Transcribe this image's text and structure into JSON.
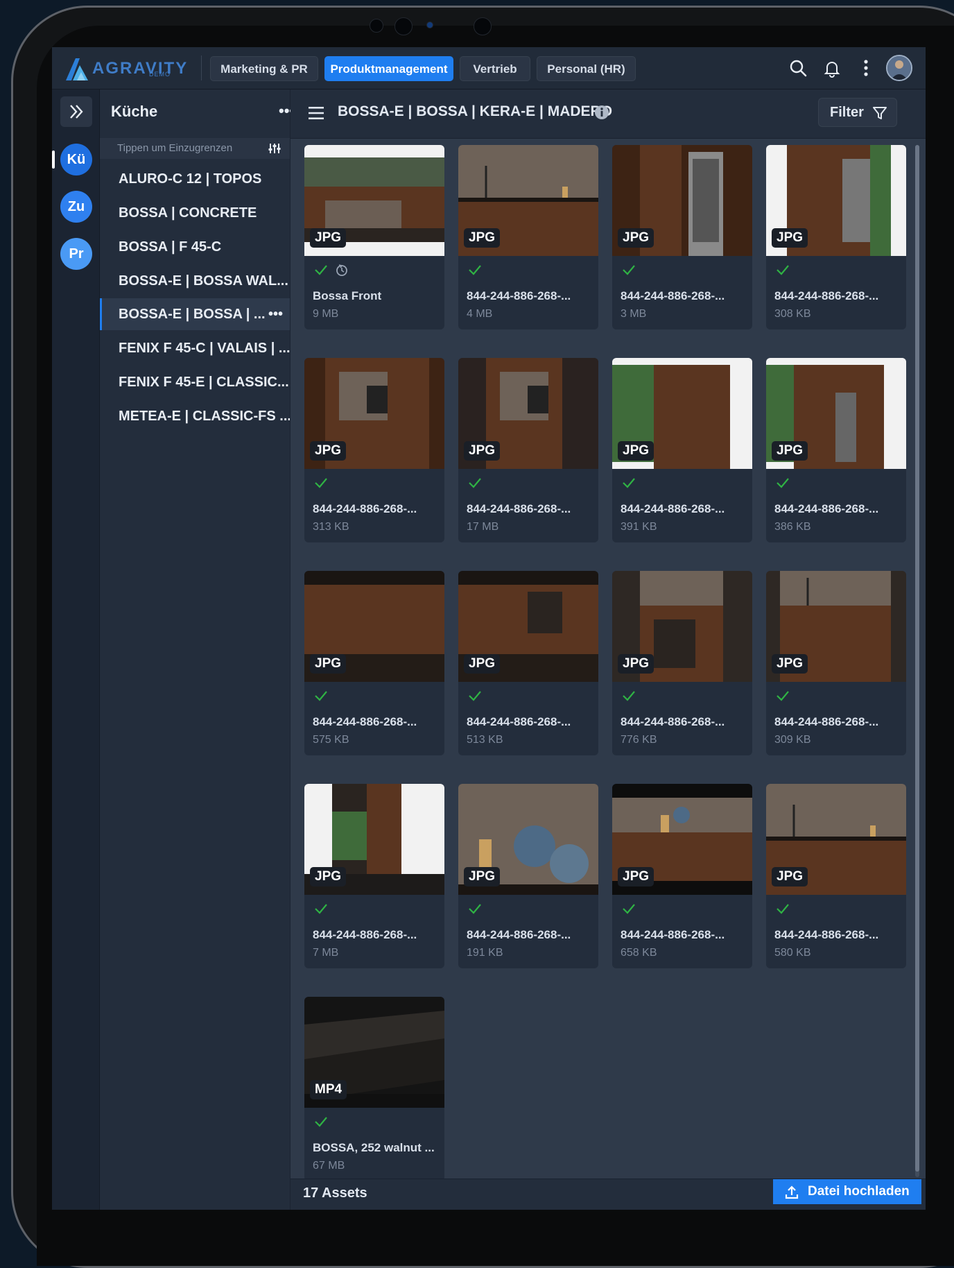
{
  "topbar": {
    "logo_text": "AGRAVITY",
    "logo_sub": "DEMO",
    "tabs": [
      {
        "label": "Marketing & PR",
        "active": false
      },
      {
        "label": "Produktmanagement",
        "active": true
      },
      {
        "label": "Vertrieb",
        "active": false
      },
      {
        "label": "Personal (HR)",
        "active": false
      }
    ],
    "icons": [
      "search-icon",
      "bell-icon",
      "kebab-menu-icon",
      "user-avatar"
    ]
  },
  "rail": {
    "collapse_icon": "double-chevron-right-icon",
    "items": [
      {
        "label": "Kü",
        "color": "#1f6fe0",
        "selected": true
      },
      {
        "label": "Zu",
        "color": "#2f80ef",
        "selected": false
      },
      {
        "label": "Pr",
        "color": "#4a9af5",
        "selected": false
      }
    ]
  },
  "sidebar": {
    "title": "Küche",
    "more": "•••",
    "filter_placeholder": "Tippen um Einzugrenzen",
    "items": [
      {
        "label": "ALURO-C 12 | TOPOS"
      },
      {
        "label": "BOSSA | CONCRETE"
      },
      {
        "label": "BOSSA | F 45-C"
      },
      {
        "label": "BOSSA-E | BOSSA WAL..."
      },
      {
        "label": "BOSSA-E | BOSSA | ...",
        "active": true,
        "more": "•••"
      },
      {
        "label": "FENIX F 45-C | VALAIS | ..."
      },
      {
        "label": "FENIX F 45-E | CLASSIC..."
      },
      {
        "label": "METEA-E | CLASSIC-FS ..."
      }
    ]
  },
  "main": {
    "path": "BOSSA-E | BOSSA | KERA-E | MADERO",
    "filter_label": "Filter",
    "assets": [
      {
        "type": "JPG",
        "name": "Bossa Front",
        "size": "9 MB",
        "thumb": "t1"
      },
      {
        "type": "JPG",
        "name": "844-244-886-268-...",
        "size": "4 MB",
        "thumb": "t2"
      },
      {
        "type": "JPG",
        "name": "844-244-886-268-...",
        "size": "3 MB",
        "thumb": "t3"
      },
      {
        "type": "JPG",
        "name": "844-244-886-268-...",
        "size": "308 KB",
        "thumb": "t4"
      },
      {
        "type": "JPG",
        "name": "844-244-886-268-...",
        "size": "313 KB",
        "thumb": "t5"
      },
      {
        "type": "JPG",
        "name": "844-244-886-268-...",
        "size": "17 MB",
        "thumb": "t6"
      },
      {
        "type": "JPG",
        "name": "844-244-886-268-...",
        "size": "391 KB",
        "thumb": "t7"
      },
      {
        "type": "JPG",
        "name": "844-244-886-268-...",
        "size": "386 KB",
        "thumb": "t8"
      },
      {
        "type": "JPG",
        "name": "844-244-886-268-...",
        "size": "575 KB",
        "thumb": "t9"
      },
      {
        "type": "JPG",
        "name": "844-244-886-268-...",
        "size": "513 KB",
        "thumb": "t10"
      },
      {
        "type": "JPG",
        "name": "844-244-886-268-...",
        "size": "776 KB",
        "thumb": "t11"
      },
      {
        "type": "JPG",
        "name": "844-244-886-268-...",
        "size": "309 KB",
        "thumb": "t12"
      },
      {
        "type": "JPG",
        "name": "844-244-886-268-...",
        "size": "7 MB",
        "thumb": "t13"
      },
      {
        "type": "JPG",
        "name": "844-244-886-268-...",
        "size": "191 KB",
        "thumb": "t14"
      },
      {
        "type": "JPG",
        "name": "844-244-886-268-...",
        "size": "658 KB",
        "thumb": "t15"
      },
      {
        "type": "JPG",
        "name": "844-244-886-268-...",
        "size": "580 KB",
        "thumb": "t16"
      },
      {
        "type": "MP4",
        "name": "BOSSA, 252 walnut ...",
        "size": "67 MB",
        "thumb": "t17"
      }
    ],
    "footer": {
      "count": "17 Assets",
      "upload_label": "Datei hochladen"
    }
  },
  "colors": {
    "accent": "#1f7ef0",
    "check_green": "#2fb344",
    "bg": "#1b2432"
  }
}
